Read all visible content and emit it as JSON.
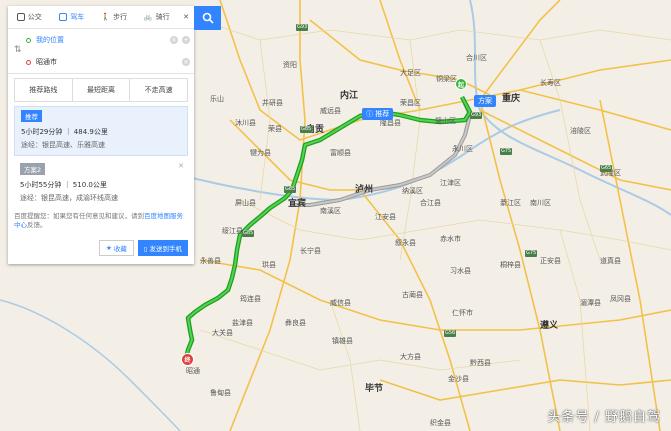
{
  "modes": [
    "公交",
    "驾车",
    "步行",
    "骑行"
  ],
  "active_mode": "驾车",
  "start": "我的位置",
  "end": "昭通市",
  "prefs": [
    "推荐路线",
    "最短距离",
    "不走高速"
  ],
  "plans": [
    {
      "tag": "推荐",
      "summary": "5小时29分钟 ｜ 484.9公里",
      "via": "途经：银昆高速、乐雅高速"
    },
    {
      "tag": "方案2",
      "summary": "5小时55分钟 ｜ 510.0公里",
      "via": "途经：银昆高速，成渝环线高速"
    }
  ],
  "note_prefix": "百度提醒您：如果您有任何意见和建议，请到",
  "note_link": "百度地图服务中心",
  "note_suffix": "反馈。",
  "fav_label": "收藏",
  "send_label": "发送到手机",
  "map_marker_label": "推荐",
  "start_marker_label": "方案",
  "cities": [
    {
      "name": "内江",
      "big": true
    },
    {
      "name": "自贡",
      "big": true
    },
    {
      "name": "宜宾",
      "big": true
    },
    {
      "name": "泸州",
      "big": true
    },
    {
      "name": "重庆",
      "big": true
    },
    {
      "name": "遵义",
      "big": true
    },
    {
      "name": "毕节",
      "big": true
    },
    {
      "name": "资阳",
      "big": false
    },
    {
      "name": "乐山",
      "big": false
    },
    {
      "name": "昭通",
      "big": false
    },
    {
      "name": "合川区",
      "big": false
    },
    {
      "name": "永川区",
      "big": false
    },
    {
      "name": "綦江区",
      "big": false
    },
    {
      "name": "江津区",
      "big": false
    },
    {
      "name": "荣县",
      "big": false
    },
    {
      "name": "富顺县",
      "big": false
    },
    {
      "name": "南溪区",
      "big": false
    },
    {
      "name": "江安县",
      "big": false
    },
    {
      "name": "长宁县",
      "big": false
    },
    {
      "name": "珙县",
      "big": false
    },
    {
      "name": "筠连县",
      "big": false
    },
    {
      "name": "盐津县",
      "big": false
    },
    {
      "name": "大关县",
      "big": false
    },
    {
      "name": "彝良县",
      "big": false
    },
    {
      "name": "威信县",
      "big": false
    },
    {
      "name": "镇雄县",
      "big": false
    },
    {
      "name": "叙永县",
      "big": false
    },
    {
      "name": "古蔺县",
      "big": false
    },
    {
      "name": "仁怀市",
      "big": false
    },
    {
      "name": "习水县",
      "big": false
    },
    {
      "name": "桐梓县",
      "big": false
    },
    {
      "name": "大方县",
      "big": false
    },
    {
      "name": "金沙县",
      "big": false
    },
    {
      "name": "鲁甸县",
      "big": false
    },
    {
      "name": "永善县",
      "big": false
    },
    {
      "name": "绥江县",
      "big": false
    },
    {
      "name": "屏山县",
      "big": false
    },
    {
      "name": "沐川县",
      "big": false
    },
    {
      "name": "犍为县",
      "big": false
    },
    {
      "name": "井研县",
      "big": false
    },
    {
      "name": "威远县",
      "big": false
    },
    {
      "name": "隆昌县",
      "big": false
    },
    {
      "name": "荣昌区",
      "big": false
    },
    {
      "name": "大足区",
      "big": false
    },
    {
      "name": "铜梁区",
      "big": false
    },
    {
      "name": "璧山区",
      "big": false
    },
    {
      "name": "南川区",
      "big": false
    },
    {
      "name": "涪陵区",
      "big": false
    },
    {
      "name": "长寿区",
      "big": false
    },
    {
      "name": "武隆区",
      "big": false
    },
    {
      "name": "道真县",
      "big": false
    },
    {
      "name": "正安县",
      "big": false
    },
    {
      "name": "湄潭县",
      "big": false
    },
    {
      "name": "凤冈县",
      "big": false
    },
    {
      "name": "黔西县",
      "big": false
    },
    {
      "name": "织金县",
      "big": false
    },
    {
      "name": "纳溪区",
      "big": false
    },
    {
      "name": "合江县",
      "big": false
    },
    {
      "name": "赤水市",
      "big": false
    }
  ],
  "watermark": "头条号 / 野鹅自驾"
}
